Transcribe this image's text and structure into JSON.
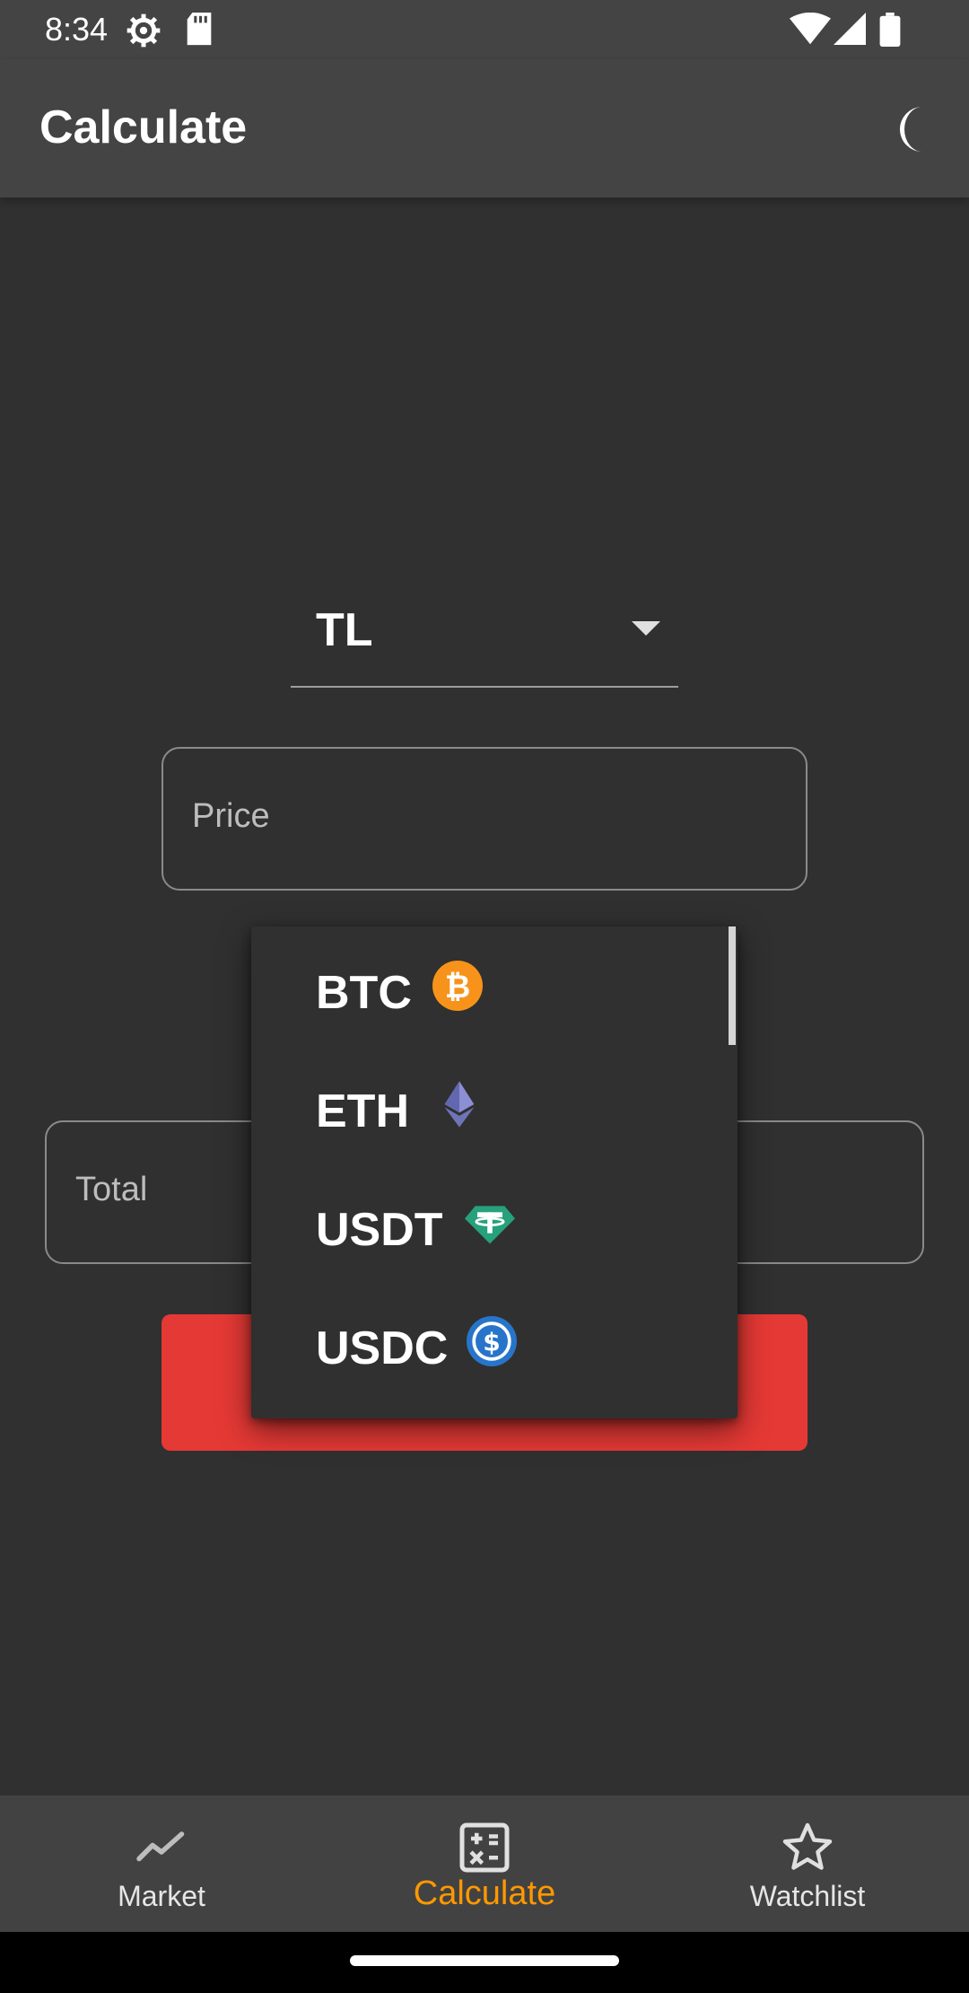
{
  "status_bar": {
    "time": "8:34",
    "icons": [
      "settings-gear-icon",
      "sd-card-icon",
      "wifi-icon",
      "signal-icon",
      "battery-icon"
    ]
  },
  "app_bar": {
    "title": "Calculate",
    "theme_icon": "moon-icon"
  },
  "form": {
    "currency_selected": "TL",
    "price_placeholder": "Price",
    "total_placeholder": "Total",
    "button_color": "#e53935"
  },
  "dropdown": {
    "items": [
      {
        "label": "BTC",
        "icon": "bitcoin-icon",
        "color": "#f7931a"
      },
      {
        "label": "ETH",
        "icon": "ethereum-icon",
        "color": "#6f74b8"
      },
      {
        "label": "USDT",
        "icon": "tether-icon",
        "color": "#26a17b"
      },
      {
        "label": "USDC",
        "icon": "usdc-icon",
        "color": "#2775ca"
      }
    ]
  },
  "bottom_nav": {
    "active": "Calculate",
    "accent": "#ff9800",
    "items": [
      {
        "label": "Market",
        "icon": "trending-line-icon"
      },
      {
        "label": "Calculate",
        "icon": "calculator-icon"
      },
      {
        "label": "Watchlist",
        "icon": "star-outline-icon"
      }
    ]
  }
}
